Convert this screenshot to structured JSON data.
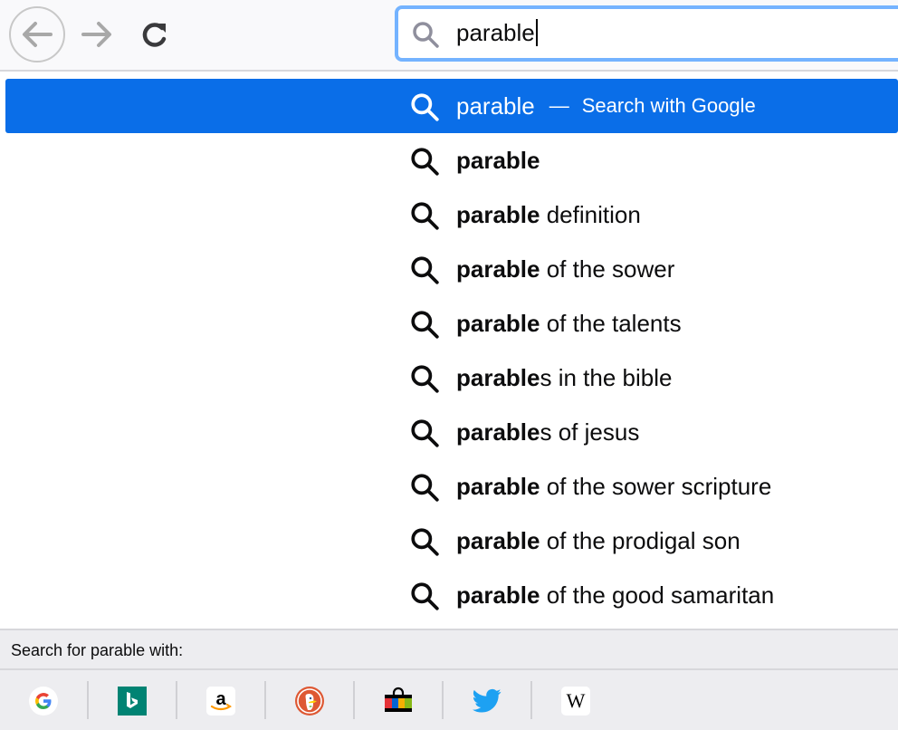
{
  "toolbar": {
    "back_icon": "back-arrow-icon",
    "forward_icon": "forward-arrow-icon",
    "reload_icon": "reload-icon"
  },
  "urlbar": {
    "icon": "search-icon",
    "value": "parable"
  },
  "results": {
    "highlight_color": "#0a6ee8",
    "items": [
      {
        "bold": "parable",
        "rest": "",
        "separator": "—",
        "action": "Search with Google",
        "selected": true
      },
      {
        "bold": "parable",
        "rest": ""
      },
      {
        "bold": "parable",
        "rest": " definition"
      },
      {
        "bold": "parable",
        "rest": " of the sower"
      },
      {
        "bold": "parable",
        "rest": " of the talents"
      },
      {
        "bold": "parable",
        "rest": "s in the bible"
      },
      {
        "bold": "parable",
        "rest": "s of jesus"
      },
      {
        "bold": "parable",
        "rest": " of the sower scripture"
      },
      {
        "bold": "parable",
        "rest": " of the prodigal son"
      },
      {
        "bold": "parable",
        "rest": " of the good samaritan"
      }
    ]
  },
  "footer": {
    "label": "Search for parable with:",
    "engines": [
      {
        "name": "Google",
        "icon": "google-icon"
      },
      {
        "name": "Bing",
        "icon": "bing-icon"
      },
      {
        "name": "Amazon",
        "icon": "amazon-icon"
      },
      {
        "name": "DuckDuckGo",
        "icon": "duckduckgo-icon"
      },
      {
        "name": "eBay",
        "icon": "shopping-bag-icon"
      },
      {
        "name": "Twitter",
        "icon": "twitter-icon"
      },
      {
        "name": "Wikipedia",
        "icon": "wikipedia-icon",
        "glyph": "W"
      }
    ]
  }
}
